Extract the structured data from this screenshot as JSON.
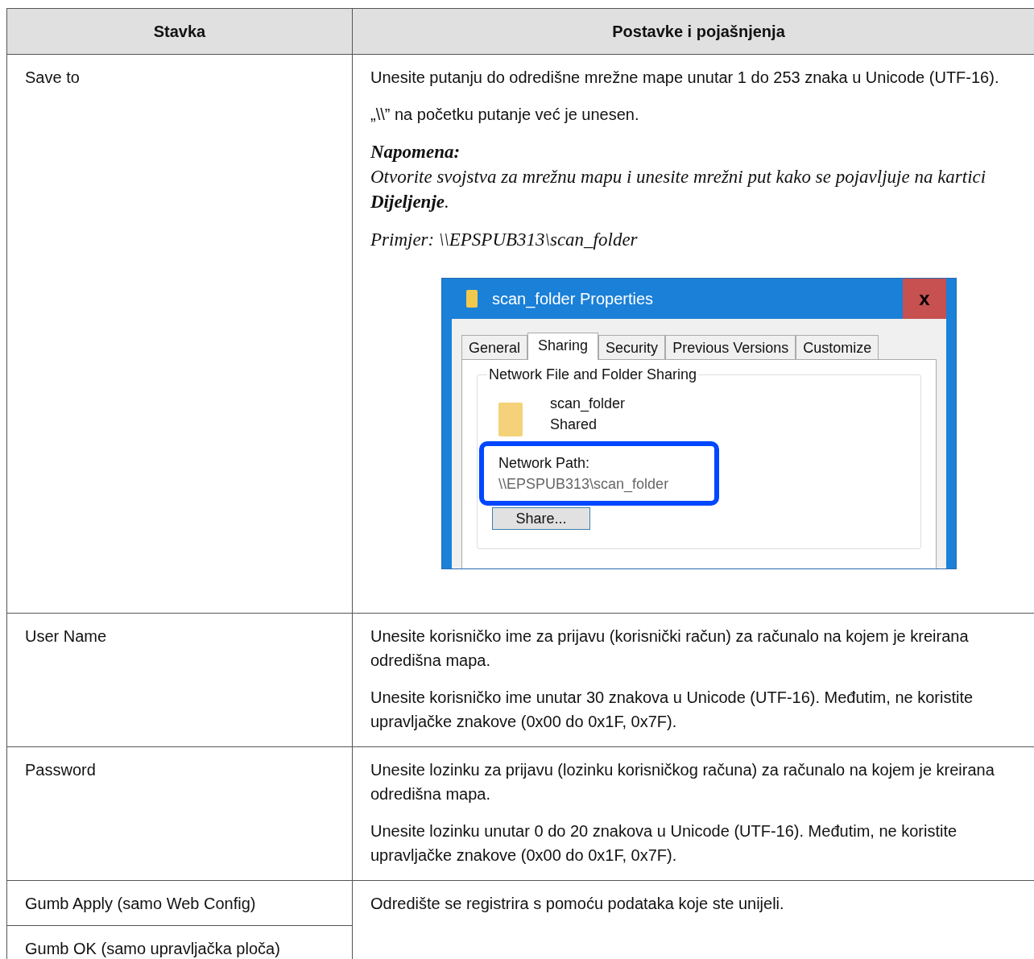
{
  "table": {
    "columns": [
      "Stavka",
      "Postavke i pojašnjenja"
    ],
    "rows": [
      {
        "items": [
          "Save to"
        ],
        "description": [
          {
            "kind": "paragraph",
            "text": "Unesite putanju do odredišne mrežne mape unutar 1 do 253 znaka u Unicode (UTF-16)."
          },
          {
            "kind": "paragraph",
            "text": "„\\\\” na početku putanje već je unesen."
          },
          {
            "kind": "note",
            "title": "Napomena:",
            "text": "Otvorite svojstva za mrežnu mapu i unesite mrežni put kako se pojavljuje na kartici **Dijeljenje**."
          },
          {
            "kind": "example",
            "text": "Primjer: \\\\EPSPUB313\\scan_folder"
          },
          {
            "kind": "screenshot",
            "dialog": {
              "title": "scan_folder Properties",
              "close": "x",
              "tabs": [
                {
                  "label": "General",
                  "selected": false
                },
                {
                  "label": "Sharing",
                  "selected": true
                },
                {
                  "label": "Security",
                  "selected": false
                },
                {
                  "label": "Previous Versions",
                  "selected": false
                },
                {
                  "label": "Customize",
                  "selected": false
                }
              ],
              "group": "Network File and Folder Sharing",
              "folder_name": "scan_folder",
              "folder_status": "Shared",
              "path_label": "Network Path:",
              "path_value": "\\\\EPSPUB313\\scan_folder",
              "highlighted": true,
              "button": "Share..."
            }
          }
        ]
      },
      {
        "items": [
          "User Name"
        ],
        "description": [
          {
            "kind": "paragraph",
            "text": "Unesite korisničko ime za prijavu (korisnički račun) za računalo na kojem je kreirana odredišna mapa."
          },
          {
            "kind": "paragraph",
            "text": "Unesite korisničko ime unutar 30 znakova u Unicode (UTF-16). Međutim, ne koristite upravljačke znakove (0x00 do 0x1F, 0x7F)."
          }
        ]
      },
      {
        "items": [
          "Password"
        ],
        "description": [
          {
            "kind": "paragraph",
            "text": "Unesite lozinku za prijavu (lozinku korisničkog računa) za računalo na kojem je kreirana odredišna mapa."
          },
          {
            "kind": "paragraph",
            "text": "Unesite lozinku unutar 0 do 20 znakova u Unicode (UTF-16). Međutim, ne koristite upravljačke znakove (0x00 do 0x1F, 0x7F)."
          }
        ]
      },
      {
        "items": [
          "Gumb Apply (samo Web Config)",
          "Gumb OK (samo upravljačka ploča)"
        ],
        "description": [
          {
            "kind": "paragraph",
            "text": "Odredište se registrira s pomoću podataka koje ste unijeli."
          }
        ]
      }
    ]
  }
}
